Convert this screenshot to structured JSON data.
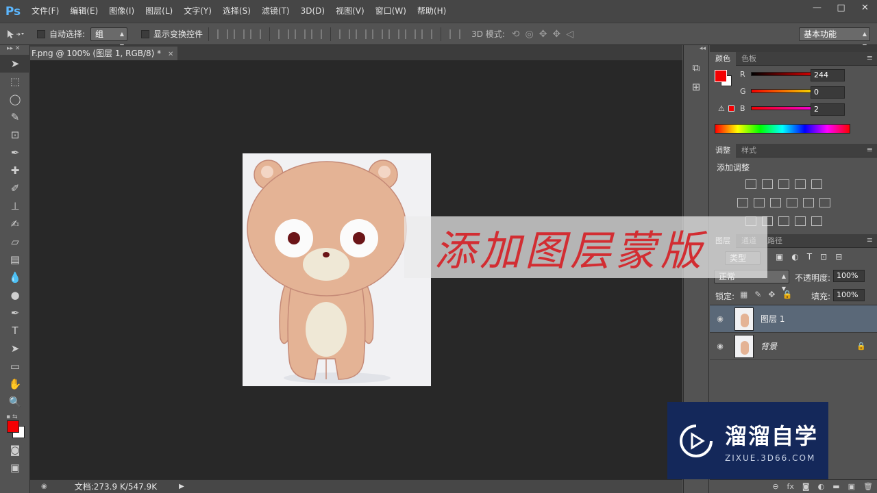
{
  "app": {
    "logo": "Ps"
  },
  "menu": [
    "文件(F)",
    "编辑(E)",
    "图像(I)",
    "图层(L)",
    "文字(Y)",
    "选择(S)",
    "滤镜(T)",
    "3D(D)",
    "视图(V)",
    "窗口(W)",
    "帮助(H)"
  ],
  "window_controls": {
    "minimize": "—",
    "maximize": "□",
    "close": "✕"
  },
  "options_bar": {
    "auto_select_label": "自动选择:",
    "auto_select_value": "组",
    "show_transform_label": "显示变换控件",
    "mode_3d_label": "3D 模式:",
    "workspace": "基本功能"
  },
  "document": {
    "tab_title": "F.png @ 100% (图层 1, RGB/8) *",
    "status": "文档:273.9 K/547.9K"
  },
  "color_panel": {
    "tabs": [
      "颜色",
      "色板"
    ],
    "r_label": "R",
    "g_label": "G",
    "b_label": "B",
    "r": "244",
    "g": "0",
    "b": "2",
    "foreground": "#f40002"
  },
  "adjust_panel": {
    "tabs": [
      "调整",
      "样式"
    ],
    "title": "添加调整"
  },
  "layers_panel": {
    "tabs": [
      "图层",
      "通道",
      "路径"
    ],
    "filter_label": "类型",
    "blend_mode": "正常",
    "opacity_label": "不透明度:",
    "opacity": "100%",
    "lock_label": "锁定:",
    "fill_label": "填充:",
    "fill": "100%",
    "layers": [
      {
        "name": "图层 1",
        "selected": true
      },
      {
        "name": "背景",
        "locked": true
      }
    ]
  },
  "overlay": {
    "caption": "添加图层蒙版"
  },
  "watermark": {
    "title": "溜溜自学",
    "subtitle": "ZIXUE.3D66.COM"
  }
}
